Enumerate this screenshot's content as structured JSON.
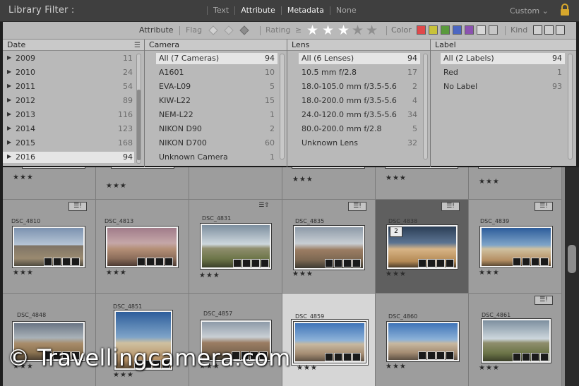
{
  "header": {
    "title": "Library Filter :",
    "modes": [
      "Text",
      "Attribute",
      "Metadata",
      "None"
    ],
    "active_mode": "Attribute",
    "preset": "Custom ⌄"
  },
  "attribute_bar": {
    "attribute_label": "Attribute",
    "flag_label": "Flag",
    "rating_label": "Rating",
    "rating_operator": "≥",
    "rating_value": 3,
    "rating_max": 5,
    "color_label": "Color",
    "kind_label": "Kind",
    "colors": [
      "#e0484a",
      "#c8c23a",
      "#5a9a3c",
      "#4c67c2",
      "#8b52b0",
      "#d0d0d0",
      "#c0c0c0"
    ]
  },
  "columns": {
    "date": {
      "header": "Date",
      "rows": [
        {
          "name": "2009",
          "count": "11"
        },
        {
          "name": "2010",
          "count": "24"
        },
        {
          "name": "2011",
          "count": "54"
        },
        {
          "name": "2012",
          "count": "89"
        },
        {
          "name": "2013",
          "count": "116"
        },
        {
          "name": "2014",
          "count": "123"
        },
        {
          "name": "2015",
          "count": "168"
        },
        {
          "name": "2016",
          "count": "94"
        }
      ]
    },
    "camera": {
      "header": "Camera",
      "rows": [
        {
          "name": "All (7 Cameras)",
          "count": "94"
        },
        {
          "name": "A1601",
          "count": "10"
        },
        {
          "name": "EVA-L09",
          "count": "5"
        },
        {
          "name": "KIW-L22",
          "count": "15"
        },
        {
          "name": "NEM-L22",
          "count": "1"
        },
        {
          "name": "NIKON D90",
          "count": "2"
        },
        {
          "name": "NIKON D700",
          "count": "60"
        },
        {
          "name": "Unknown Camera",
          "count": "1"
        }
      ]
    },
    "lens": {
      "header": "Lens",
      "rows": [
        {
          "name": "All (6 Lenses)",
          "count": "94"
        },
        {
          "name": "10.5 mm f/2.8",
          "count": "17"
        },
        {
          "name": "18.0-105.0 mm f/3.5-5.6",
          "count": "2"
        },
        {
          "name": "18.0-200.0 mm f/3.5-5.6",
          "count": "4"
        },
        {
          "name": "24.0-120.0 mm f/3.5-5.6",
          "count": "34"
        },
        {
          "name": "80.0-200.0 mm f/2.8",
          "count": "5"
        },
        {
          "name": "Unknown Lens",
          "count": "32"
        }
      ]
    },
    "label": {
      "header": "Label",
      "rows": [
        {
          "name": "All (2 Labels)",
          "count": "94"
        },
        {
          "name": "Red",
          "count": "1"
        },
        {
          "name": "No Label",
          "count": "93"
        }
      ]
    }
  },
  "grid": {
    "row1": [
      "",
      "",
      "",
      "",
      "",
      ""
    ],
    "row2": [
      {
        "file": "DSC_4810",
        "stars": "★★★",
        "copies": ""
      },
      {
        "file": "DSC_4813",
        "stars": "★★★",
        "copies": ""
      },
      {
        "file": "DSC_4831",
        "stars": "★★★",
        "copies": ""
      },
      {
        "file": "DSC_4835",
        "stars": "★★★",
        "copies": ""
      },
      {
        "file": "DSC_4838",
        "stars": "★★★",
        "copies": "2"
      },
      {
        "file": "DSC_4839",
        "stars": "★★★",
        "copies": ""
      }
    ],
    "row3": [
      {
        "file": "DSC_4848",
        "stars": "★★★"
      },
      {
        "file": "DSC_4851",
        "stars": "★★★"
      },
      {
        "file": "DSC_4857",
        "stars": "★★★"
      },
      {
        "file": "DSC_4859",
        "stars": "★★★"
      },
      {
        "file": "DSC_4860",
        "stars": "★★★"
      },
      {
        "file": "DSC_4861",
        "stars": "★★★"
      }
    ],
    "row1_stars": "★★★"
  },
  "watermark": "© Travellingcamera.com"
}
